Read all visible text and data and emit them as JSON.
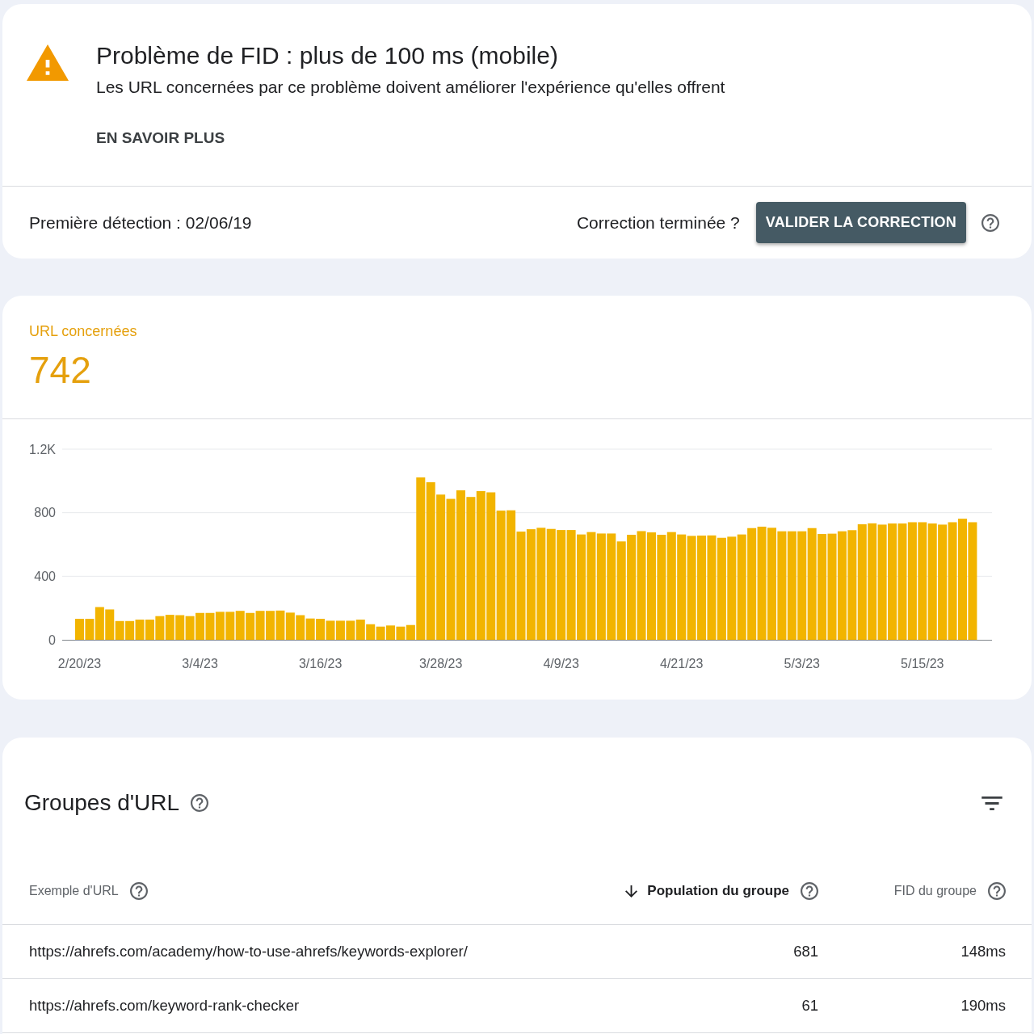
{
  "issue": {
    "title": "Problème de FID : plus de 100 ms (mobile)",
    "description": "Les URL concernées par ce problème doivent améliorer l'expérience qu'elles offrent",
    "link": "EN SAVOIR PLUS",
    "first_detection": "Première détection : 02/06/19",
    "fix_prompt": "Correction terminée ?",
    "validate_button": "VALIDER LA CORRECTION"
  },
  "summary": {
    "label": "URL concernées",
    "count": "742",
    "chart_data": {
      "type": "bar",
      "categories": [
        "2/20/23",
        null,
        null,
        null,
        null,
        null,
        null,
        null,
        null,
        null,
        null,
        null,
        "3/4/23",
        null,
        null,
        null,
        null,
        null,
        null,
        null,
        null,
        null,
        null,
        null,
        "3/16/23",
        null,
        null,
        null,
        null,
        null,
        null,
        null,
        null,
        null,
        null,
        null,
        "3/28/23",
        null,
        null,
        null,
        null,
        null,
        null,
        null,
        null,
        null,
        null,
        null,
        "4/9/23",
        null,
        null,
        null,
        null,
        null,
        null,
        null,
        null,
        null,
        null,
        null,
        "4/21/23",
        null,
        null,
        null,
        null,
        null,
        null,
        null,
        null,
        null,
        null,
        null,
        "5/3/23",
        null,
        null,
        null,
        null,
        null,
        null,
        null,
        null,
        null,
        null,
        null,
        "5/15/23",
        null,
        null,
        null,
        null,
        null
      ],
      "values": [
        132,
        132,
        206,
        191,
        118,
        118,
        127,
        127,
        149,
        157,
        155,
        149,
        169,
        169,
        176,
        176,
        182,
        169,
        182,
        182,
        184,
        171,
        155,
        134,
        132,
        120,
        120,
        120,
        127,
        98,
        83,
        90,
        83,
        93,
        1022,
        992,
        914,
        887,
        941,
        899,
        936,
        928,
        813,
        815,
        681,
        696,
        705,
        698,
        691,
        691,
        663,
        678,
        669,
        669,
        619,
        661,
        684,
        676,
        661,
        678,
        663,
        654,
        656,
        657,
        642,
        649,
        663,
        703,
        712,
        705,
        683,
        683,
        683,
        703,
        666,
        668,
        683,
        690,
        727,
        733,
        725,
        732,
        732,
        740,
        740,
        732,
        725,
        740,
        762,
        740
      ],
      "ylim": [
        0,
        1200
      ],
      "yticks": [
        0,
        400,
        800,
        {
          "value": 1200,
          "label": "1.2K"
        }
      ]
    }
  },
  "url_groups": {
    "title": "Groupes d'URL",
    "columns": [
      {
        "label": "Exemple d'URL",
        "sorted": false
      },
      {
        "label": "Population du groupe",
        "sorted": true
      },
      {
        "label": "FID du groupe",
        "sorted": false
      }
    ],
    "rows": [
      {
        "cells": [
          "https://ahrefs.com/academy/how-to-use-ahrefs/keywords-explorer/",
          "681",
          "148ms"
        ]
      },
      {
        "cells": [
          "https://ahrefs.com/keyword-rank-checker",
          "61",
          "190ms"
        ]
      }
    ]
  }
}
